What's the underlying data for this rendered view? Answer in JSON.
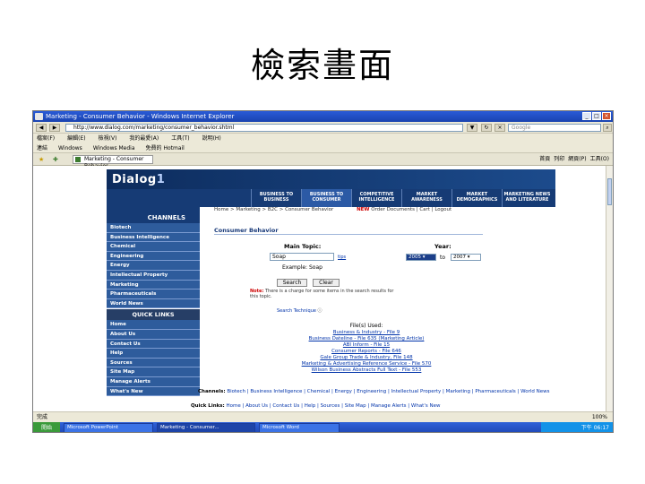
{
  "slide": {
    "title": "檢索畫面"
  },
  "browser": {
    "window_title": "Marketing - Consumer Behavior - Windows Internet Explorer",
    "address": "http://www.dialog.com/marketing/consumer_behavior.shtml",
    "search_placeholder": "Google",
    "menu": [
      "檔案(F)",
      "編輯(E)",
      "檢視(V)",
      "我的最愛(A)",
      "工具(T)",
      "說明(H)"
    ],
    "links": [
      "連結",
      "Windows",
      "Windows Media",
      "免費的 Hotmail"
    ],
    "tab_title": "Marketing - Consumer Behavior",
    "tab_tools": [
      "首頁",
      "列印",
      "網頁(P)",
      "工具(O)"
    ],
    "status": "完成",
    "zoom": "100%"
  },
  "site": {
    "logo_main": "Dialog",
    "logo_num": "1",
    "nav": [
      {
        "label": "BUSINESS TO BUSINESS",
        "active": false
      },
      {
        "label": "BUSINESS TO CONSUMER",
        "active": true
      },
      {
        "label": "COMPETITIVE INTELLIGENCE",
        "active": false
      },
      {
        "label": "MARKET AWARENESS",
        "active": false
      },
      {
        "label": "MARKET DEMOGRAPHICS",
        "active": false
      },
      {
        "label": "MARKETING NEWS AND LITERATURE",
        "active": false
      }
    ],
    "channels_head": "CHANNELS",
    "channels": [
      "Biotech",
      "Business Intelligence",
      "Chemical",
      "Engineering",
      "Energy",
      "Intellectual Property",
      "Marketing",
      "Pharmaceuticals",
      "World News"
    ],
    "quick_head": "QUICK LINKS",
    "quick": [
      "Home",
      "About Us",
      "Contact Us",
      "Help",
      "Sources",
      "Site Map",
      "Manage Alerts",
      "What's New"
    ]
  },
  "main": {
    "breadcrumb": "Home > Marketing > B2C > Consumer Behavior",
    "breadcrumb_new": "NEW",
    "breadcrumb_tail": "Order Documents | Cart | Logout",
    "section_title": "Consumer Behavior",
    "topic_label": "Main Topic:",
    "topic_value": "Soap",
    "tips_link": "tips",
    "example": "Example: Soap",
    "year_label": "Year:",
    "year_from": "2005",
    "year_to_word": "to",
    "year_to": "2007",
    "search_btn": "Search",
    "clear_btn": "Clear",
    "note_label": "Note:",
    "note_text": "There is a charge for some items in the search results for this topic.",
    "search_tech": "Search Technique",
    "files_title": "File(s) Used:",
    "files": [
      "Business & Industry - File 9",
      "Business Dateline - File 635 (Marketing Article)",
      "ABI Inform - File 15",
      "Consumer Reports - File 646",
      "Gale Group Trade & Industry, File 148",
      "Marketing & Advertising Reference Service - File 570",
      "Wilson Business Abstracts Full Text - File 553"
    ],
    "footer_channels_label": "Channels:",
    "footer_channels": "Biotech | Business Intelligence | Chemical | Energy | Engineering | Intellectual Property | Marketing | Pharmaceuticals | World News",
    "footer_quick_label": "Quick Links:",
    "footer_quick": "Home | About Us | Contact Us | Help | Sources | Site Map | Manage Alerts | What's New"
  },
  "taskbar": {
    "start": "開始",
    "items": [
      "Microsoft PowerPoint",
      "Marketing - Consumer...",
      "Microsoft Word"
    ],
    "clock": "下午 06:17"
  }
}
